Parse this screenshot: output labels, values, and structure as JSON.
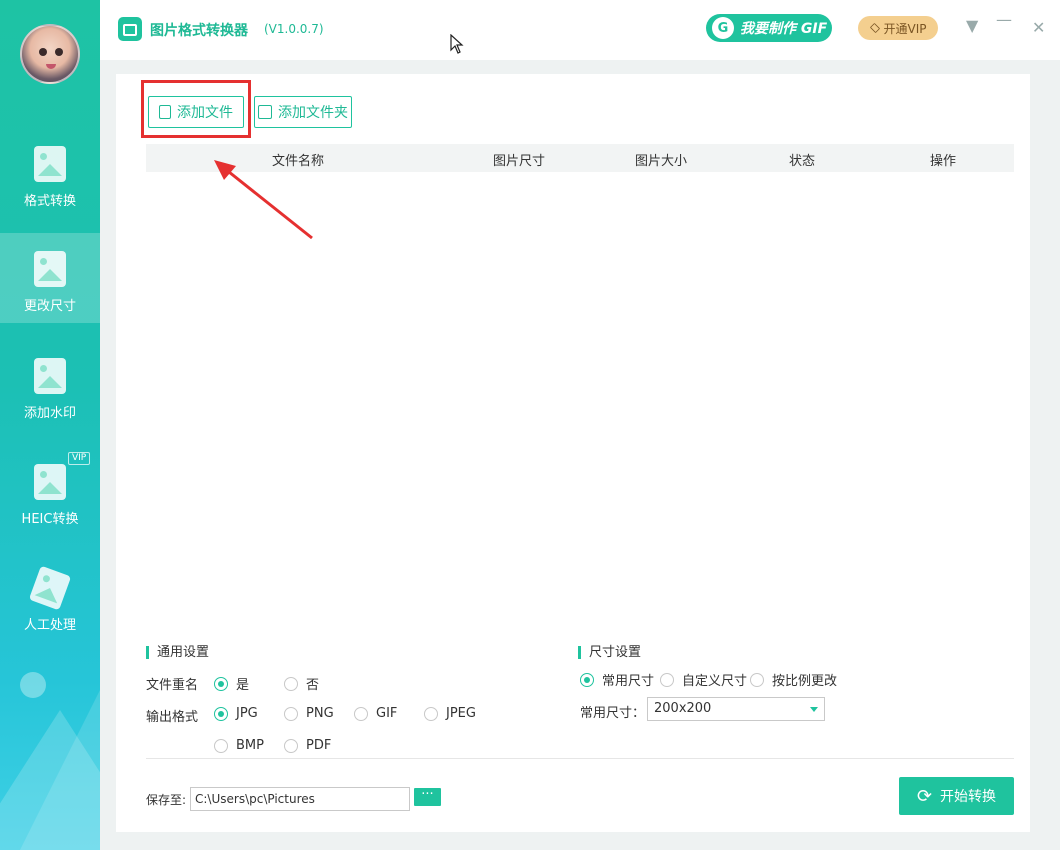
{
  "sidebar": {
    "items": [
      {
        "label": "格式转换"
      },
      {
        "label": "更改尺寸"
      },
      {
        "label": "添加水印"
      },
      {
        "label": "HEIC转换"
      },
      {
        "label": "人工处理"
      }
    ],
    "vip_tag": "VIP"
  },
  "titlebar": {
    "title": "图片格式转换器",
    "version": "(V1.0.0.7)",
    "gif_button": "我要制作 GIF",
    "gif_letter": "G",
    "vip_button": "开通VIP"
  },
  "toolbar": {
    "add_file": "添加文件",
    "add_folder": "添加文件夹"
  },
  "table": {
    "columns": [
      "文件名称",
      "图片尺寸",
      "图片大小",
      "状态",
      "操作"
    ]
  },
  "general_settings": {
    "title": "通用设置",
    "rename_label": "文件重名",
    "rename_options": [
      "是",
      "否"
    ],
    "rename_selected": "是",
    "format_label": "输出格式",
    "format_options": [
      "JPG",
      "PNG",
      "GIF",
      "JPEG",
      "BMP",
      "PDF"
    ],
    "format_selected": "JPG"
  },
  "size_settings": {
    "title": "尺寸设置",
    "mode_options": [
      "常用尺寸",
      "自定义尺寸",
      "按比例更改"
    ],
    "mode_selected": "常用尺寸",
    "common_size_label": "常用尺寸：",
    "common_size_value": "200x200"
  },
  "footer": {
    "save_label": "保存至:",
    "save_path": "C:\\Users\\pc\\Pictures",
    "browse_label": "···",
    "start_button": "开始转换"
  },
  "colors": {
    "accent": "#1fc39e",
    "highlight": "#e53030"
  }
}
